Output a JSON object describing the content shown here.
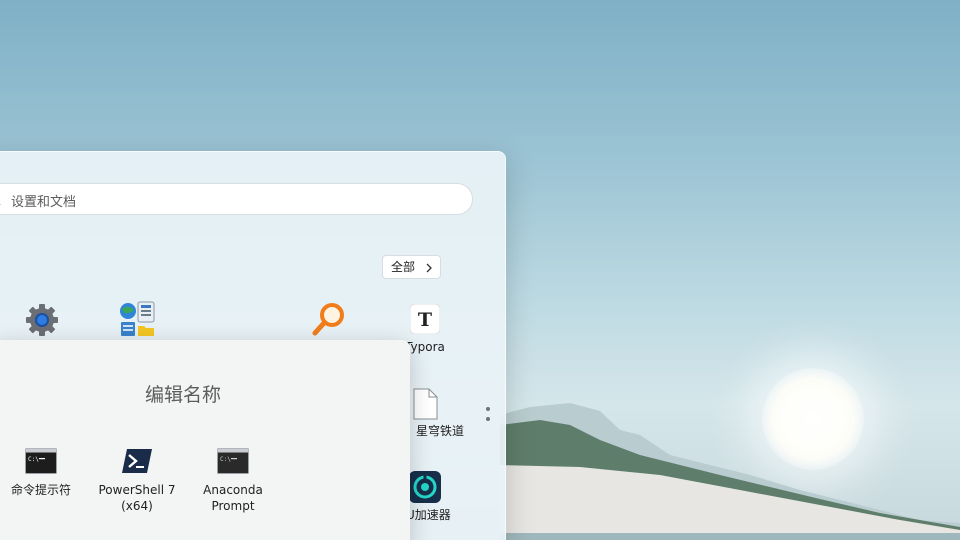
{
  "search": {
    "placeholder": "设置和文档"
  },
  "pinned": {
    "all_button": "全部",
    "apps": [
      {
        "name": "",
        "icon": "settings-gear-icon"
      },
      {
        "name": "",
        "icon": "control-panel-icon"
      },
      {
        "name": "",
        "icon": "everything-search-icon"
      },
      {
        "name": "Typora",
        "icon": "typora-icon"
      },
      {
        "name": "：星穹铁道",
        "icon": "blank-file-icon"
      },
      {
        "name": "U加速器",
        "icon": "accelerator-icon"
      }
    ]
  },
  "folder": {
    "title": "编辑名称",
    "apps": [
      {
        "name": "命令提示符",
        "icon": "cmd-icon"
      },
      {
        "name": "PowerShell 7",
        "name2": "(x64)",
        "icon": "powershell-icon"
      },
      {
        "name": "Anaconda",
        "name2": "Prompt",
        "icon": "anaconda-prompt-icon"
      }
    ]
  },
  "colors": {
    "accent": "#0067c0",
    "panel": "#e9f2f7",
    "folder": "#f3f5f4"
  }
}
